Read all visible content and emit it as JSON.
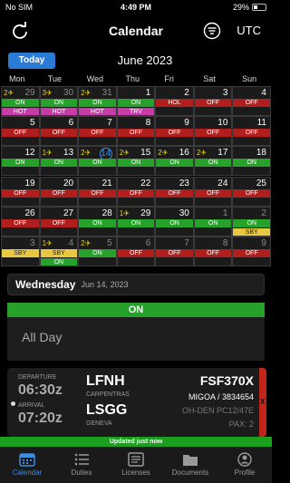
{
  "status": {
    "carrier": "No SIM",
    "time": "4:49 PM",
    "battery": "29%"
  },
  "nav": {
    "title": "Calendar",
    "timezone": "UTC"
  },
  "calendar": {
    "today_label": "Today",
    "month": "June 2023",
    "weekdays": [
      "Mon",
      "Tue",
      "Wed",
      "Thu",
      "Fri",
      "Sat",
      "Sun"
    ],
    "weeks": [
      [
        {
          "day": "29",
          "dim": true,
          "plane": "2✈",
          "tags": [
            {
              "t": "ON",
              "c": "#26a22a"
            },
            {
              "t": "HOT",
              "c": "#c83ca8"
            }
          ]
        },
        {
          "day": "30",
          "dim": true,
          "plane": "3✈",
          "tags": [
            {
              "t": "ON",
              "c": "#26a22a"
            },
            {
              "t": "HOT",
              "c": "#c83ca8"
            }
          ]
        },
        {
          "day": "31",
          "dim": true,
          "plane": "2✈",
          "tags": [
            {
              "t": "ON",
              "c": "#26a22a"
            },
            {
              "t": "HOT",
              "c": "#c83ca8"
            }
          ]
        },
        {
          "day": "1",
          "plane": "",
          "tags": [
            {
              "t": "ON",
              "c": "#26a22a"
            },
            {
              "t": "TRV",
              "c": "#c83ca8"
            }
          ]
        },
        {
          "day": "2",
          "plane": "",
          "tags": [
            {
              "t": "HOL",
              "c": "#b01e1e"
            }
          ]
        },
        {
          "day": "3",
          "plane": "",
          "tags": [
            {
              "t": "OFF",
              "c": "#b01e1e"
            }
          ]
        },
        {
          "day": "4",
          "plane": "",
          "tags": [
            {
              "t": "OFF",
              "c": "#b01e1e"
            }
          ]
        }
      ],
      [
        {
          "day": "5",
          "plane": "",
          "tags": [
            {
              "t": "OFF",
              "c": "#b01e1e"
            }
          ]
        },
        {
          "day": "6",
          "plane": "",
          "tags": [
            {
              "t": "OFF",
              "c": "#b01e1e"
            }
          ]
        },
        {
          "day": "7",
          "plane": "",
          "tags": [
            {
              "t": "OFF",
              "c": "#b01e1e"
            }
          ]
        },
        {
          "day": "8",
          "plane": "",
          "tags": [
            {
              "t": "OFF",
              "c": "#b01e1e"
            }
          ]
        },
        {
          "day": "9",
          "plane": "",
          "tags": [
            {
              "t": "OFF",
              "c": "#b01e1e"
            }
          ]
        },
        {
          "day": "10",
          "plane": "",
          "tags": [
            {
              "t": "OFF",
              "c": "#b01e1e"
            }
          ]
        },
        {
          "day": "11",
          "plane": "",
          "tags": [
            {
              "t": "OFF",
              "c": "#b01e1e"
            }
          ]
        }
      ],
      [
        {
          "day": "12",
          "plane": "",
          "tags": [
            {
              "t": "ON",
              "c": "#26a22a"
            }
          ]
        },
        {
          "day": "13",
          "plane": "1✈",
          "tags": [
            {
              "t": "ON",
              "c": "#26a22a"
            }
          ]
        },
        {
          "day": "14",
          "today": true,
          "plane": "2✈",
          "tags": [
            {
              "t": "ON",
              "c": "#26a22a"
            }
          ]
        },
        {
          "day": "15",
          "plane": "2✈",
          "tags": [
            {
              "t": "ON",
              "c": "#26a22a"
            }
          ]
        },
        {
          "day": "16",
          "plane": "2✈",
          "tags": [
            {
              "t": "ON",
              "c": "#26a22a"
            }
          ]
        },
        {
          "day": "17",
          "plane": "2✈",
          "tags": [
            {
              "t": "ON",
              "c": "#26a22a"
            }
          ]
        },
        {
          "day": "18",
          "plane": "",
          "tags": [
            {
              "t": "ON",
              "c": "#26a22a"
            }
          ]
        }
      ],
      [
        {
          "day": "19",
          "plane": "",
          "tags": [
            {
              "t": "OFF",
              "c": "#b01e1e"
            }
          ]
        },
        {
          "day": "20",
          "plane": "",
          "tags": [
            {
              "t": "OFF",
              "c": "#b01e1e"
            }
          ]
        },
        {
          "day": "21",
          "plane": "",
          "tags": [
            {
              "t": "OFF",
              "c": "#b01e1e"
            }
          ]
        },
        {
          "day": "22",
          "plane": "",
          "tags": [
            {
              "t": "OFF",
              "c": "#b01e1e"
            }
          ]
        },
        {
          "day": "23",
          "plane": "",
          "tags": [
            {
              "t": "OFF",
              "c": "#b01e1e"
            }
          ]
        },
        {
          "day": "24",
          "plane": "",
          "tags": [
            {
              "t": "OFF",
              "c": "#b01e1e"
            }
          ]
        },
        {
          "day": "25",
          "plane": "",
          "tags": [
            {
              "t": "OFF",
              "c": "#b01e1e"
            }
          ]
        }
      ],
      [
        {
          "day": "26",
          "plane": "",
          "tags": [
            {
              "t": "OFF",
              "c": "#b01e1e"
            }
          ]
        },
        {
          "day": "27",
          "plane": "",
          "tags": [
            {
              "t": "OFF",
              "c": "#b01e1e"
            }
          ]
        },
        {
          "day": "28",
          "plane": "",
          "tags": [
            {
              "t": "ON",
              "c": "#26a22a"
            }
          ]
        },
        {
          "day": "29",
          "plane": "1✈",
          "tags": [
            {
              "t": "ON",
              "c": "#26a22a"
            }
          ]
        },
        {
          "day": "30",
          "plane": "",
          "tags": [
            {
              "t": "ON",
              "c": "#26a22a"
            }
          ]
        },
        {
          "day": "1",
          "dim": true,
          "plane": "",
          "tags": [
            {
              "t": "ON",
              "c": "#26a22a"
            }
          ]
        },
        {
          "day": "2",
          "dim": true,
          "plane": "",
          "tags": [
            {
              "t": "ON",
              "c": "#26a22a"
            },
            {
              "t": "SBY",
              "c": "#e8c840"
            }
          ]
        }
      ],
      [
        {
          "day": "3",
          "dim": true,
          "plane": "",
          "tags": [
            {
              "t": "SBY",
              "c": "#e8c840"
            }
          ]
        },
        {
          "day": "4",
          "dim": true,
          "plane": "1✈",
          "tags": [
            {
              "t": "SBY",
              "c": "#e8c840"
            },
            {
              "t": "ON",
              "c": "#26a22a"
            }
          ]
        },
        {
          "day": "5",
          "dim": true,
          "plane": "2✈",
          "tags": [
            {
              "t": "ON",
              "c": "#26a22a"
            }
          ]
        },
        {
          "day": "6",
          "dim": true,
          "plane": "",
          "tags": [
            {
              "t": "OFF",
              "c": "#b01e1e"
            }
          ]
        },
        {
          "day": "7",
          "dim": true,
          "plane": "",
          "tags": [
            {
              "t": "OFF",
              "c": "#b01e1e"
            }
          ]
        },
        {
          "day": "8",
          "dim": true,
          "plane": "",
          "tags": [
            {
              "t": "OFF",
              "c": "#b01e1e"
            }
          ]
        },
        {
          "day": "9",
          "dim": true,
          "plane": "",
          "tags": [
            {
              "t": "OFF",
              "c": "#b01e1e"
            }
          ]
        }
      ]
    ]
  },
  "day_detail": {
    "weekday": "Wednesday",
    "date": "Jun 14, 2023",
    "duty": "ON",
    "all_day": "All Day"
  },
  "flight": {
    "departure_label": "DEPARTURE",
    "departure_time": "06:30z",
    "arrival_label": "ARRIVAL",
    "arrival_time": "07:20z",
    "from_code": "LFNH",
    "from_name": "CARPENTRAS",
    "to_code": "LSGG",
    "to_name": "GENEVA",
    "flight_no": "FSF370X",
    "crew": "MIGOA / 3834654",
    "aircraft": "OH-DEN PC12/47E",
    "pax": "PAX: 2",
    "flag": "X"
  },
  "update_banner": "Updated just now",
  "tabs": [
    {
      "label": "Calendar",
      "active": true
    },
    {
      "label": "Duties"
    },
    {
      "label": "Licenses"
    },
    {
      "label": "Documents"
    },
    {
      "label": "Profile"
    }
  ],
  "colors": {
    "accent": "#3b8de0",
    "on": "#26a22a",
    "off": "#b01e1e",
    "hot": "#c83ca8",
    "sby": "#e8c840"
  }
}
